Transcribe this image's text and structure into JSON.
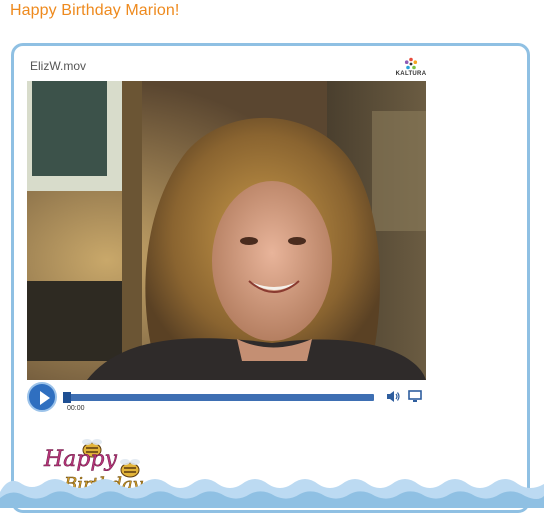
{
  "page": {
    "title": "Happy Birthday Marion!"
  },
  "player": {
    "file_name": "ElizW.mov",
    "brand": "KALTURA",
    "time": "00:00",
    "progress": 0
  },
  "sticker": {
    "text_line1": "Happy",
    "text_line2": "Birthday"
  },
  "colors": {
    "title": "#ee8a1e",
    "card_border": "#8fc0e3",
    "accent": "#2f6fc0"
  },
  "icons": [
    "play-icon",
    "volume-icon",
    "fullscreen-icon",
    "kaltura-logo"
  ]
}
